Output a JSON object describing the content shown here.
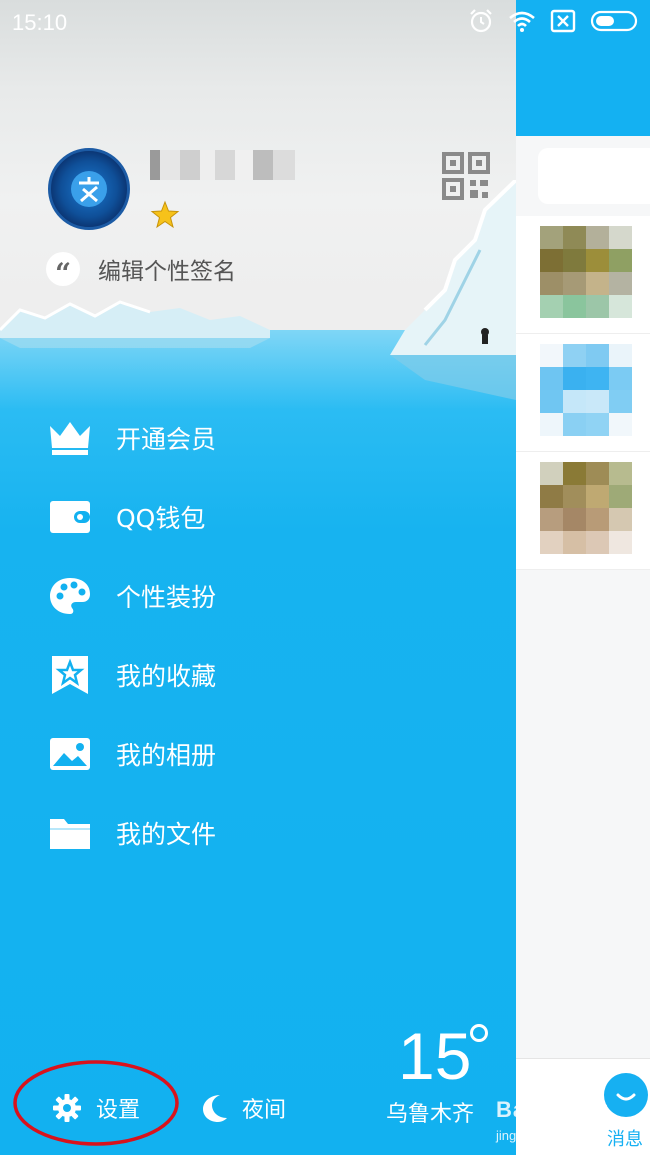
{
  "status_bar": {
    "time": "15:10",
    "icons": [
      "alarm-icon",
      "wifi-icon",
      "no-sim-icon",
      "battery-icon"
    ]
  },
  "profile": {
    "level_icon": "star-icon",
    "qr_icon": "qr-code-icon",
    "signature_placeholder": "编辑个性签名"
  },
  "menu": {
    "items": [
      {
        "label": "开通会员",
        "icon": "crown-icon"
      },
      {
        "label": "QQ钱包",
        "icon": "wallet-icon"
      },
      {
        "label": "个性装扮",
        "icon": "palette-icon"
      },
      {
        "label": "我的收藏",
        "icon": "bookmark-star-icon"
      },
      {
        "label": "我的相册",
        "icon": "image-icon"
      },
      {
        "label": "我的文件",
        "icon": "folder-icon"
      }
    ]
  },
  "bottom": {
    "settings_label": "设置",
    "night_label": "夜间",
    "weather_temp": "15",
    "weather_city": "乌鲁木齐"
  },
  "right_pane": {
    "messages_label": "消息"
  },
  "watermark": {
    "main": "Baidu经验",
    "sub": "jingyan.baidu.com"
  },
  "colors": {
    "drawer_blue": "#12b1f0",
    "header_blue": "#14b1f2",
    "annotation_red": "#d9121c"
  }
}
